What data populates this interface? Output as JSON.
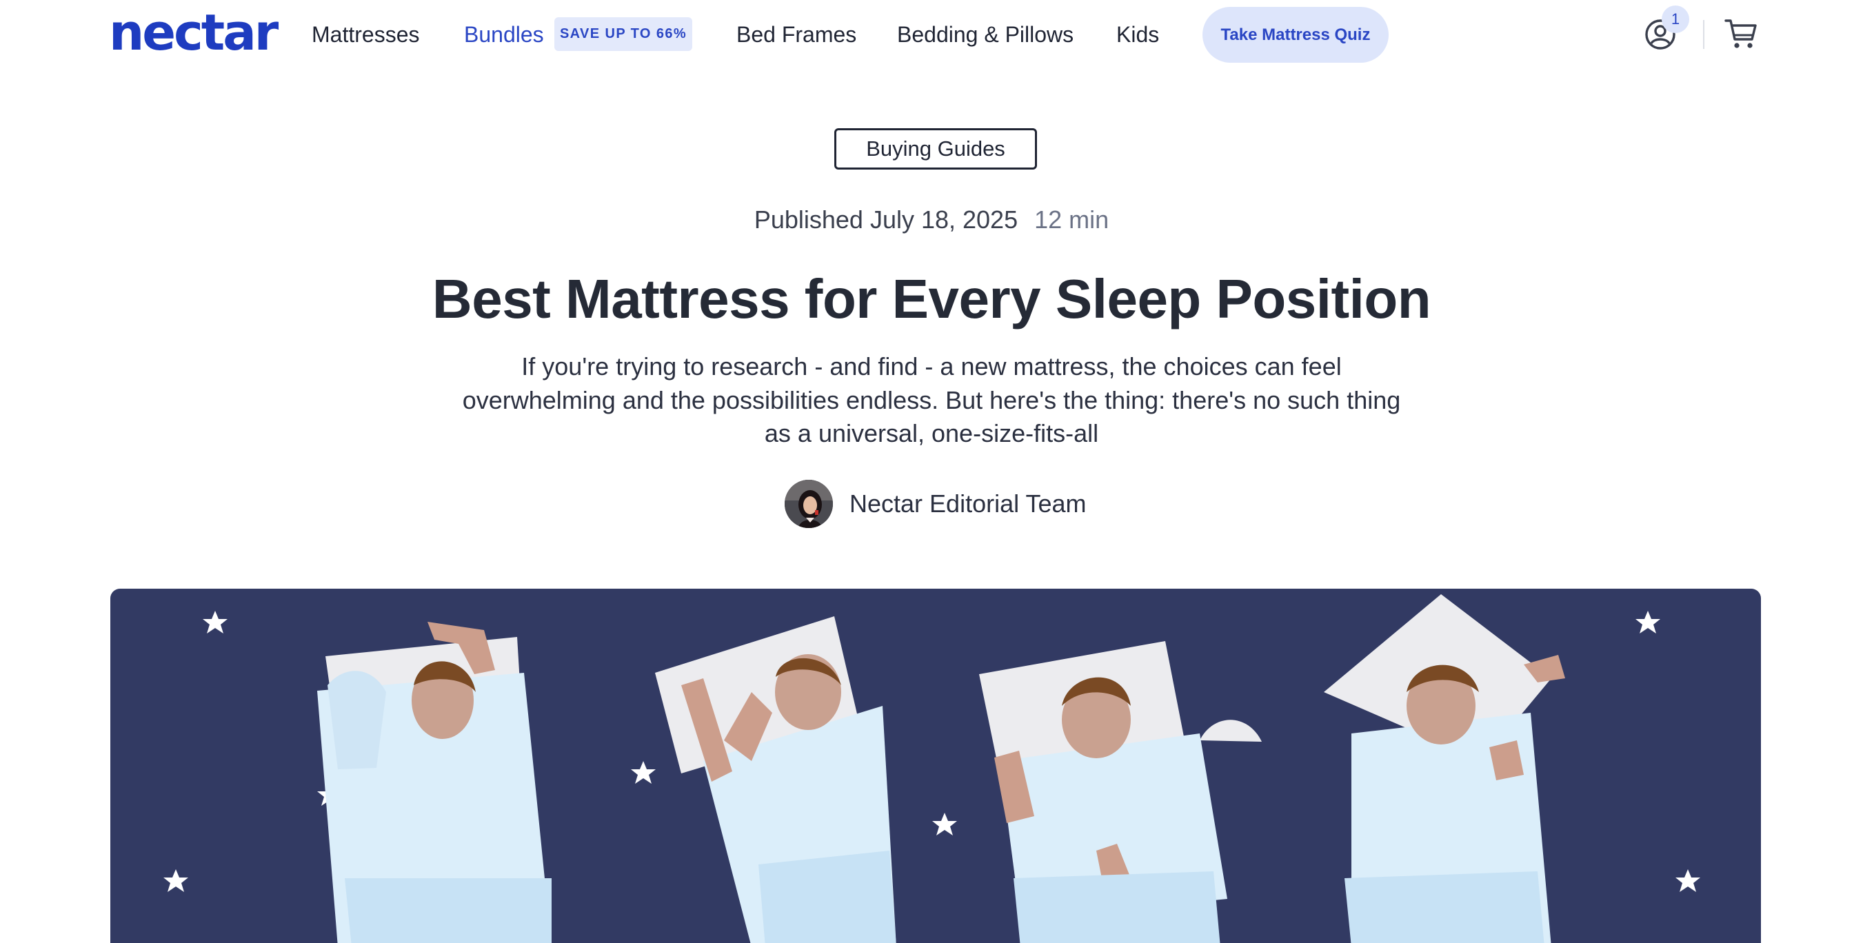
{
  "header": {
    "logo": "nectar",
    "nav": [
      {
        "label": "Mattresses"
      },
      {
        "label": "Bundles",
        "badge": "SAVE UP TO 66%"
      },
      {
        "label": "Bed Frames"
      },
      {
        "label": "Bedding & Pillows"
      },
      {
        "label": "Kids"
      }
    ],
    "quiz_button": "Take Mattress Quiz",
    "account_badge": "1",
    "icons": [
      "account-icon",
      "cart-icon"
    ]
  },
  "article": {
    "category": "Buying Guides",
    "published": "Published July 18, 2025",
    "read_time": "12 min",
    "title": "Best Mattress for Every Sleep Position",
    "intro": "If you're trying to research - and find - a new mattress, the choices can feel overwhelming and the possibilities endless. But here's the thing: there's no such thing as a universal, one-size-fits-all",
    "author": "Nectar Editorial Team"
  },
  "colors": {
    "brand": "#1e3cc0",
    "accent_bg": "#dde5fb",
    "hero_bg": "#323a63",
    "text": "#1f2433"
  }
}
